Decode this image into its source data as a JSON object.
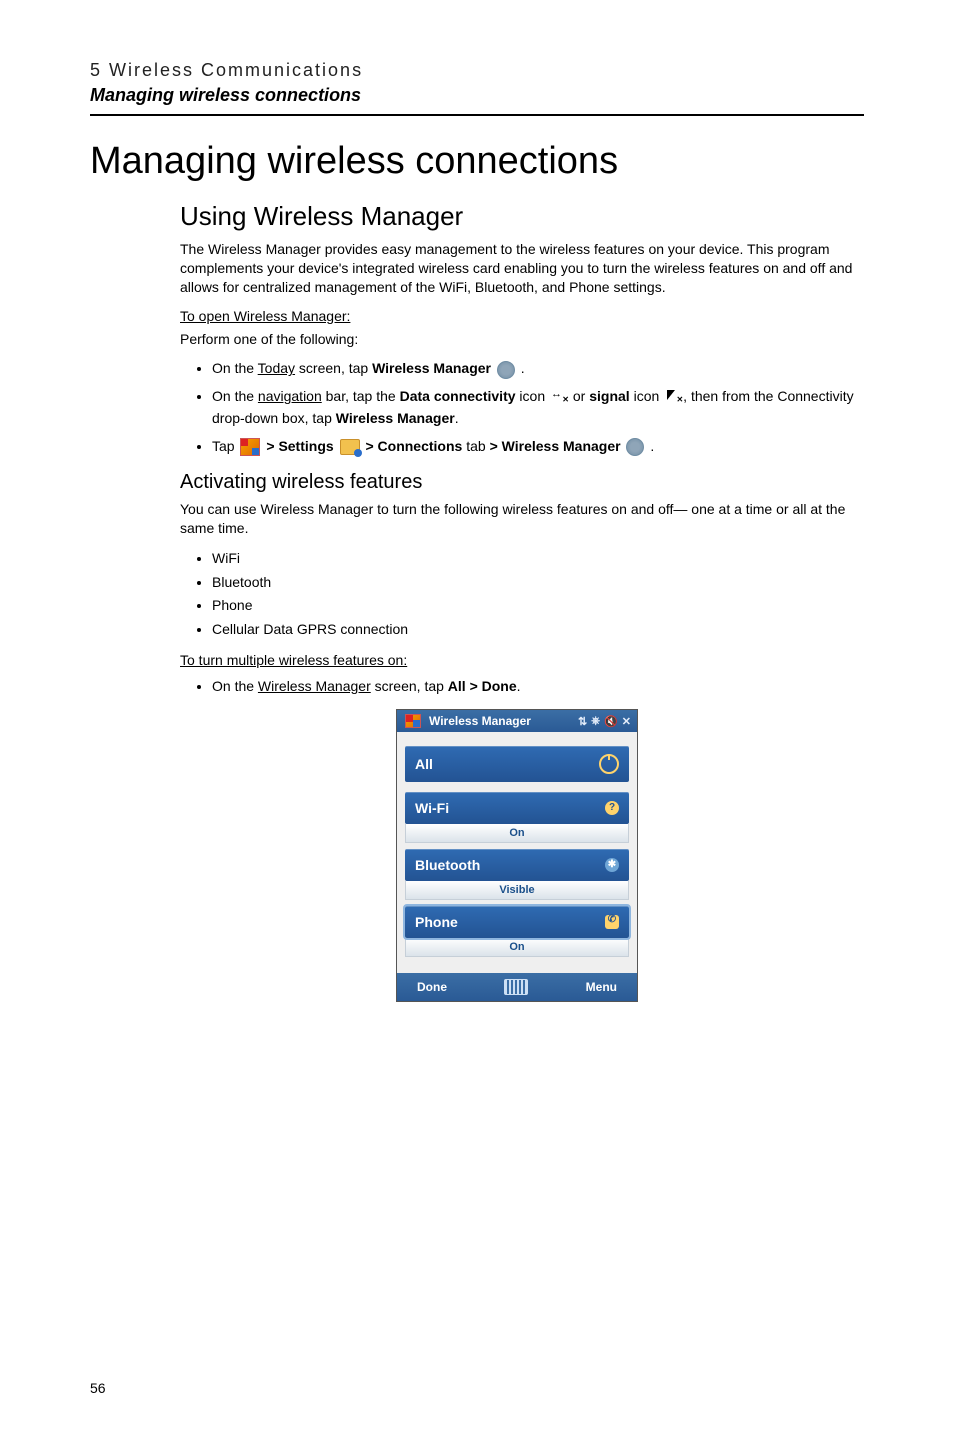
{
  "page_number": "56",
  "header": {
    "chapter": "5 Wireless Communications",
    "section_italic": "Managing wireless connections"
  },
  "h1": "Managing wireless connections",
  "h2": "Using Wireless Manager",
  "intro": "The Wireless Manager provides easy management to the wireless features on your device. This program complements your device's integrated wireless card enabling you to turn the wireless features on and off and allows for centralized management of the WiFi, Bluetooth, and Phone settings.",
  "open_head": "To open Wireless Manager:",
  "open_sub": "Perform one of the following:",
  "open_items": {
    "a_pre": "On the ",
    "a_link": "Today",
    "a_mid": " screen, tap ",
    "a_bold": "Wireless Manager",
    "a_post": " .",
    "b_pre": "On the ",
    "b_link": "navigation",
    "b_mid": " bar, tap the ",
    "b_bold1": "Data connectivity",
    "b_between": " icon ",
    "b_or": " or ",
    "b_bold2": "signal",
    "b_icon2": " icon ",
    "b_line2_pre": ", then from the Connectivity drop-down box, tap ",
    "b_line2_bold": "Wireless Manager",
    "b_line2_post": ".",
    "c_pre": "Tap ",
    "c_gt1": " > ",
    "c_settings": "Settings",
    "c_gt2": "  > ",
    "c_conn": "Connections",
    "c_tab": " tab ",
    "c_gt3": "> ",
    "c_wm": "Wireless Manager",
    "c_post": " ."
  },
  "h3": "Activating wireless features",
  "act_body": "You can use Wireless Manager to turn the following wireless features on and off— one at a time or all at the same time.",
  "feature_list": [
    "WiFi",
    "Bluetooth",
    "Phone",
    "Cellular Data GPRS connection"
  ],
  "turn_on_head": "To turn multiple wireless features on:",
  "turn_on_item_pre": "On the ",
  "turn_on_item_link": "Wireless Manager",
  "turn_on_item_mid": " screen, tap ",
  "turn_on_item_bold": "All > Done",
  "turn_on_item_post": ".",
  "shot": {
    "title": "Wireless Manager",
    "sys_icons": [
      "⇅",
      "⎈",
      "🔇",
      "✕"
    ],
    "all": "All",
    "wifi": {
      "label": "Wi-Fi",
      "status": "On"
    },
    "bt": {
      "label": "Bluetooth",
      "status": "Visible"
    },
    "phone": {
      "label": "Phone",
      "status": "On"
    },
    "menu_left": "Done",
    "menu_right": "Menu"
  }
}
